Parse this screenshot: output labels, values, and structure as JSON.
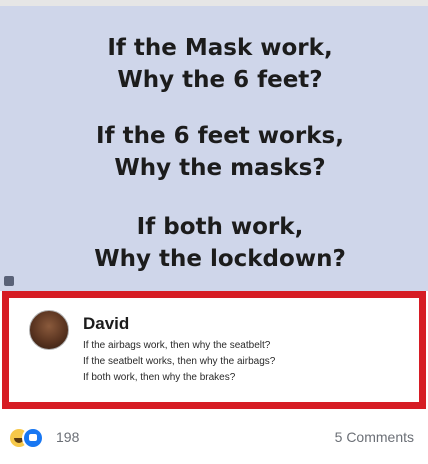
{
  "meme": {
    "lines": [
      "If the Mask work,",
      "Why the 6 feet?",
      "If the 6 feet works,",
      "Why the masks?",
      "If both work,",
      "Why the lockdown?"
    ]
  },
  "comment": {
    "author": "David",
    "lines": [
      "If the airbags work, then why the seatbelt?",
      "If the seatbelt works, then why the airbags?",
      "If both work, then why the brakes?"
    ]
  },
  "footer": {
    "reaction_count": "198",
    "comments_label": "5 Comments"
  },
  "colors": {
    "panel_background": "#cfd6ea",
    "highlight_border": "#d61c24",
    "like_blue": "#1877f2",
    "haha_yellow": "#f7c94a"
  },
  "icons": {
    "reactions": [
      "haha-icon",
      "like-icon"
    ]
  }
}
